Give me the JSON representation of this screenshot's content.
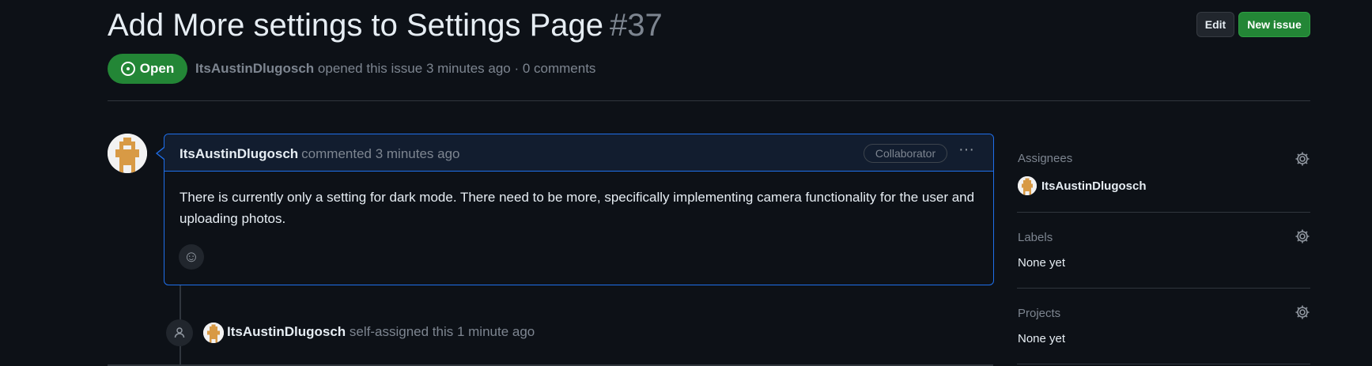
{
  "issue": {
    "title": "Add More settings to Settings Page",
    "number": "#37",
    "state": "Open",
    "author": "ItsAustinDlugosch",
    "meta": "opened this issue 3 minutes ago · 0 comments"
  },
  "header_buttons": {
    "edit": "Edit",
    "new_issue": "New issue"
  },
  "comment": {
    "author": "ItsAustinDlugosch",
    "action": "commented 3 minutes ago",
    "badge": "Collaborator",
    "menu": "···",
    "body": "There is currently only a setting for dark mode. There need to be more, specifically implementing camera functionality for the user and uploading photos.",
    "reaction_icon": "☺"
  },
  "timeline_event": {
    "icon": "person-icon",
    "author": "ItsAustinDlugosch",
    "text": "self-assigned this 1 minute ago"
  },
  "sidebar": {
    "assignees": {
      "heading": "Assignees",
      "value": "ItsAustinDlugosch"
    },
    "labels": {
      "heading": "Labels",
      "value": "None yet"
    },
    "projects": {
      "heading": "Projects",
      "value": "None yet"
    }
  },
  "colors": {
    "background": "#0d1117",
    "open_green": "#238636",
    "accent_blue": "#1f6feb",
    "muted_text": "#7d8590",
    "avatar_orange": "#d89a45"
  }
}
